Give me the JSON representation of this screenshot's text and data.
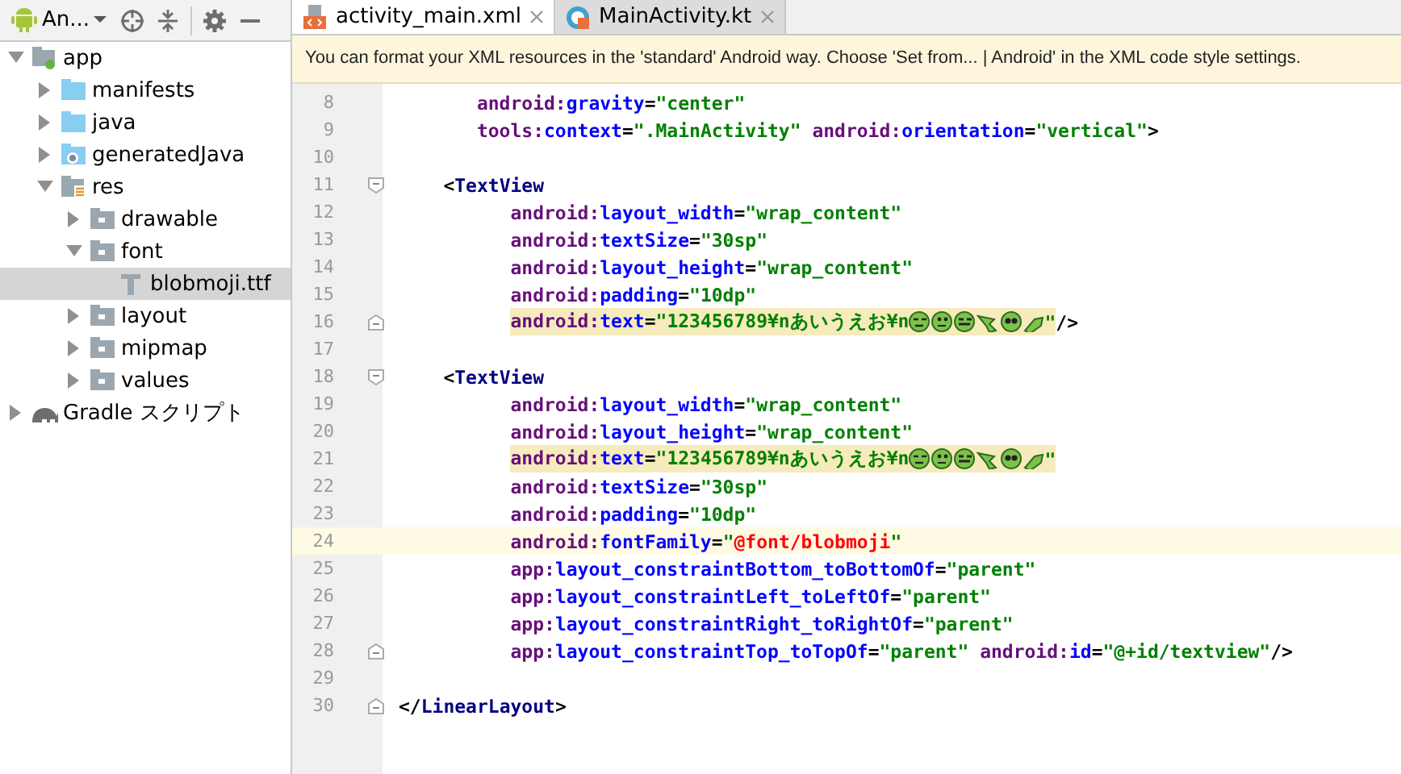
{
  "project_panel": {
    "view_label": "An...",
    "tree": [
      {
        "label": "app",
        "kind": "module",
        "expanded": true,
        "selected": false,
        "children": [
          {
            "label": "manifests",
            "kind": "source-folder",
            "expanded": false,
            "selected": false
          },
          {
            "label": "java",
            "kind": "source-folder",
            "expanded": false,
            "selected": false
          },
          {
            "label": "generatedJava",
            "kind": "generated-folder",
            "expanded": false,
            "selected": false
          },
          {
            "label": "res",
            "kind": "res-root",
            "expanded": true,
            "selected": false,
            "children": [
              {
                "label": "drawable",
                "kind": "res-folder",
                "expanded": false,
                "selected": false
              },
              {
                "label": "font",
                "kind": "res-folder",
                "expanded": true,
                "selected": false,
                "children": [
                  {
                    "label": "blobmoji.ttf",
                    "kind": "font-file",
                    "selected": true
                  }
                ]
              },
              {
                "label": "layout",
                "kind": "res-folder",
                "expanded": false,
                "selected": false
              },
              {
                "label": "mipmap",
                "kind": "res-folder",
                "expanded": false,
                "selected": false
              },
              {
                "label": "values",
                "kind": "res-folder",
                "expanded": false,
                "selected": false
              }
            ]
          }
        ]
      },
      {
        "label": "Gradle スクリプト",
        "kind": "gradle",
        "expanded": false,
        "selected": false
      }
    ]
  },
  "tabs": [
    {
      "label": "activity_main.xml",
      "kind": "xml",
      "selected": true
    },
    {
      "label": "MainActivity.kt",
      "kind": "kotlin",
      "selected": false
    }
  ],
  "banner": "You can format your XML resources in the 'standard' Android way. Choose 'Set from... | Android' in the XML code style settings.",
  "lines": [
    {
      "number": "8",
      "kind": "root-attribute",
      "fold_start": false,
      "fold_end": false,
      "current": false,
      "highlighted": false,
      "tokens": [
        {
          "kind": "ns",
          "text": "android:"
        },
        {
          "kind": "name",
          "text": "gravity"
        },
        {
          "kind": "punct",
          "text": "="
        },
        {
          "kind": "value",
          "text": "\"center\""
        }
      ]
    },
    {
      "number": "9",
      "kind": "root-attribute",
      "fold_start": false,
      "fold_end": false,
      "current": false,
      "highlighted": false,
      "tokens": [
        {
          "kind": "ns",
          "text": "tools:"
        },
        {
          "kind": "name",
          "text": "context"
        },
        {
          "kind": "punct",
          "text": "="
        },
        {
          "kind": "value",
          "text": "\".MainActivity\""
        },
        {
          "kind": "ns",
          "text": " android:"
        },
        {
          "kind": "name",
          "text": "orientation"
        },
        {
          "kind": "punct",
          "text": "="
        },
        {
          "kind": "value",
          "text": "\"vertical\""
        },
        {
          "kind": "punct",
          "text": ">"
        }
      ]
    },
    {
      "number": "10",
      "kind": "blank",
      "fold_start": false,
      "fold_end": false,
      "current": false,
      "highlighted": false
    },
    {
      "number": "11",
      "kind": "child-tag",
      "fold_start": true,
      "fold_end": false,
      "current": false,
      "highlighted": false,
      "tokens": [
        {
          "kind": "punct",
          "text": "<"
        },
        {
          "kind": "tag",
          "text": "TextView"
        }
      ]
    },
    {
      "number": "12",
      "kind": "child-attribute",
      "fold_start": false,
      "fold_end": false,
      "current": false,
      "highlighted": false,
      "tokens": [
        {
          "kind": "ns",
          "text": "android:"
        },
        {
          "kind": "name",
          "text": "layout_width"
        },
        {
          "kind": "punct",
          "text": "="
        },
        {
          "kind": "value",
          "text": "\"wrap_content\""
        }
      ]
    },
    {
      "number": "13",
      "kind": "child-attribute",
      "fold_start": false,
      "fold_end": false,
      "current": false,
      "highlighted": false,
      "tokens": [
        {
          "kind": "ns",
          "text": "android:"
        },
        {
          "kind": "name",
          "text": "textSize"
        },
        {
          "kind": "punct",
          "text": "="
        },
        {
          "kind": "value",
          "text": "\"30sp\""
        }
      ]
    },
    {
      "number": "14",
      "kind": "child-attribute",
      "fold_start": false,
      "fold_end": false,
      "current": false,
      "highlighted": false,
      "tokens": [
        {
          "kind": "ns",
          "text": "android:"
        },
        {
          "kind": "name",
          "text": "layout_height"
        },
        {
          "kind": "punct",
          "text": "="
        },
        {
          "kind": "value",
          "text": "\"wrap_content\""
        }
      ]
    },
    {
      "number": "15",
      "kind": "child-attribute",
      "fold_start": false,
      "fold_end": false,
      "current": false,
      "highlighted": false,
      "tokens": [
        {
          "kind": "ns",
          "text": "android:"
        },
        {
          "kind": "name",
          "text": "padding"
        },
        {
          "kind": "punct",
          "text": "="
        },
        {
          "kind": "value",
          "text": "\"10dp\""
        }
      ]
    },
    {
      "number": "16",
      "kind": "child-attribute",
      "fold_start": false,
      "fold_end": true,
      "current": false,
      "highlighted": true,
      "tokens": [
        {
          "kind": "ns",
          "text": "android:"
        },
        {
          "kind": "name",
          "text": "text"
        },
        {
          "kind": "punct",
          "text": "="
        },
        {
          "kind": "value",
          "text": "\"123456789¥nあいうえお¥n"
        },
        {
          "kind": "emoji"
        },
        {
          "kind": "value",
          "text": "\""
        }
      ],
      "trailing": [
        {
          "kind": "punct",
          "text": "/>"
        }
      ]
    },
    {
      "number": "17",
      "kind": "blank",
      "fold_start": false,
      "fold_end": false,
      "current": false,
      "highlighted": false
    },
    {
      "number": "18",
      "kind": "child-tag",
      "fold_start": true,
      "fold_end": false,
      "current": false,
      "highlighted": false,
      "tokens": [
        {
          "kind": "punct",
          "text": "<"
        },
        {
          "kind": "tag",
          "text": "TextView"
        }
      ]
    },
    {
      "number": "19",
      "kind": "child-attribute",
      "fold_start": false,
      "fold_end": false,
      "current": false,
      "highlighted": false,
      "tokens": [
        {
          "kind": "ns",
          "text": "android:"
        },
        {
          "kind": "name",
          "text": "layout_width"
        },
        {
          "kind": "punct",
          "text": "="
        },
        {
          "kind": "value",
          "text": "\"wrap_content\""
        }
      ]
    },
    {
      "number": "20",
      "kind": "child-attribute",
      "fold_start": false,
      "fold_end": false,
      "current": false,
      "highlighted": false,
      "tokens": [
        {
          "kind": "ns",
          "text": "android:"
        },
        {
          "kind": "name",
          "text": "layout_height"
        },
        {
          "kind": "punct",
          "text": "="
        },
        {
          "kind": "value",
          "text": "\"wrap_content\""
        }
      ]
    },
    {
      "number": "21",
      "kind": "child-attribute",
      "fold_start": false,
      "fold_end": false,
      "current": false,
      "highlighted": true,
      "tokens": [
        {
          "kind": "ns",
          "text": "android:"
        },
        {
          "kind": "name",
          "text": "text"
        },
        {
          "kind": "punct",
          "text": "="
        },
        {
          "kind": "value",
          "text": "\"123456789¥nあいうえお¥n"
        },
        {
          "kind": "emoji"
        },
        {
          "kind": "value",
          "text": "\""
        }
      ]
    },
    {
      "number": "22",
      "kind": "child-attribute",
      "fold_start": false,
      "fold_end": false,
      "current": false,
      "highlighted": false,
      "tokens": [
        {
          "kind": "ns",
          "text": "android:"
        },
        {
          "kind": "name",
          "text": "textSize"
        },
        {
          "kind": "punct",
          "text": "="
        },
        {
          "kind": "value",
          "text": "\"30sp\""
        }
      ]
    },
    {
      "number": "23",
      "kind": "child-attribute",
      "fold_start": false,
      "fold_end": false,
      "current": false,
      "highlighted": false,
      "tokens": [
        {
          "kind": "ns",
          "text": "android:"
        },
        {
          "kind": "name",
          "text": "padding"
        },
        {
          "kind": "punct",
          "text": "="
        },
        {
          "kind": "value",
          "text": "\"10dp\""
        }
      ]
    },
    {
      "number": "24",
      "kind": "child-attribute",
      "fold_start": false,
      "fold_end": false,
      "current": true,
      "highlighted": false,
      "tokens": [
        {
          "kind": "ns",
          "text": "android:"
        },
        {
          "kind": "name",
          "text": "fontFamily"
        },
        {
          "kind": "punct",
          "text": "="
        },
        {
          "kind": "value",
          "text": "\""
        },
        {
          "kind": "ref",
          "text": "@font/blobmoji"
        },
        {
          "kind": "value",
          "text": "\""
        }
      ]
    },
    {
      "number": "25",
      "kind": "child-attribute",
      "fold_start": false,
      "fold_end": false,
      "current": false,
      "highlighted": false,
      "tokens": [
        {
          "kind": "ns",
          "text": "app:"
        },
        {
          "kind": "name",
          "text": "layout_constraintBottom_toBottomOf"
        },
        {
          "kind": "punct",
          "text": "="
        },
        {
          "kind": "value",
          "text": "\"parent\""
        }
      ]
    },
    {
      "number": "26",
      "kind": "child-attribute",
      "fold_start": false,
      "fold_end": false,
      "current": false,
      "highlighted": false,
      "tokens": [
        {
          "kind": "ns",
          "text": "app:"
        },
        {
          "kind": "name",
          "text": "layout_constraintLeft_toLeftOf"
        },
        {
          "kind": "punct",
          "text": "="
        },
        {
          "kind": "value",
          "text": "\"parent\""
        }
      ]
    },
    {
      "number": "27",
      "kind": "child-attribute",
      "fold_start": false,
      "fold_end": false,
      "current": false,
      "highlighted": false,
      "tokens": [
        {
          "kind": "ns",
          "text": "app:"
        },
        {
          "kind": "name",
          "text": "layout_constraintRight_toRightOf"
        },
        {
          "kind": "punct",
          "text": "="
        },
        {
          "kind": "value",
          "text": "\"parent\""
        }
      ]
    },
    {
      "number": "28",
      "kind": "child-attribute",
      "fold_start": false,
      "fold_end": true,
      "current": false,
      "highlighted": false,
      "tokens": [
        {
          "kind": "ns",
          "text": "app:"
        },
        {
          "kind": "name",
          "text": "layout_constraintTop_toTopOf"
        },
        {
          "kind": "punct",
          "text": "="
        },
        {
          "kind": "value",
          "text": "\"parent\""
        },
        {
          "kind": "ns",
          "text": " android:"
        },
        {
          "kind": "name",
          "text": "id"
        },
        {
          "kind": "punct",
          "text": "="
        },
        {
          "kind": "value",
          "text": "\"@+id/textview\""
        },
        {
          "kind": "punct",
          "text": "/>"
        }
      ]
    },
    {
      "number": "29",
      "kind": "blank",
      "fold_start": false,
      "fold_end": false,
      "current": false,
      "highlighted": false
    },
    {
      "number": "30",
      "kind": "root-tag",
      "fold_start": false,
      "fold_end": true,
      "current": false,
      "highlighted": false,
      "tokens": [
        {
          "kind": "punct",
          "text": "</"
        },
        {
          "kind": "tag",
          "text": "LinearLayout"
        },
        {
          "kind": "punct",
          "text": ">"
        }
      ]
    }
  ]
}
